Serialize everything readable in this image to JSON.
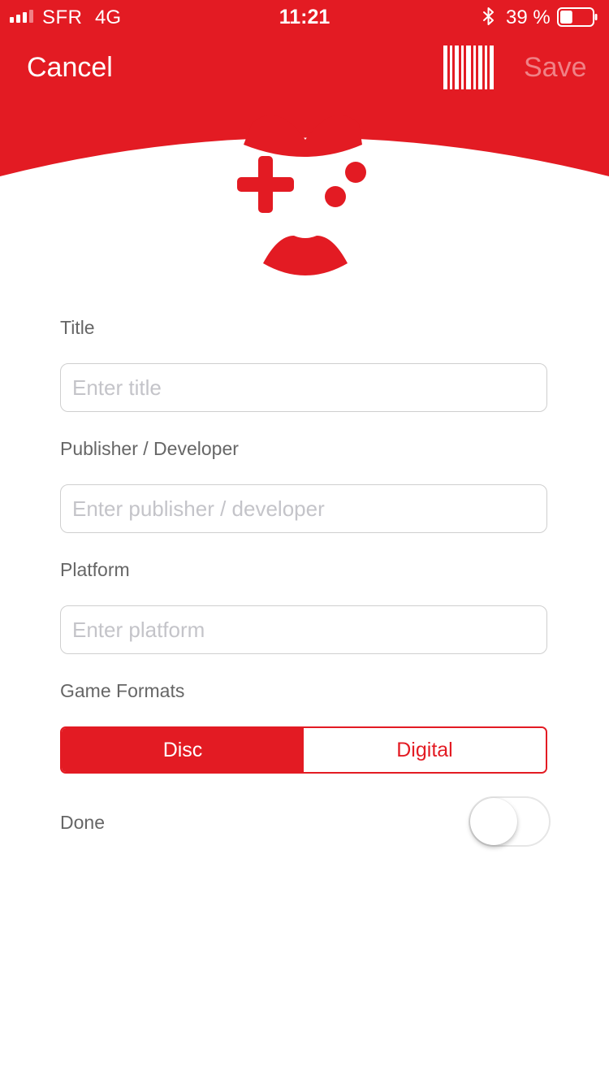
{
  "status_bar": {
    "carrier": "SFR",
    "network": "4G",
    "time": "11:21",
    "battery_percent": "39 %",
    "signal_bars_on": 3,
    "signal_bars_total": 4,
    "battery_level": 0.39
  },
  "nav": {
    "cancel_label": "Cancel",
    "save_label": "Save",
    "barcode_icon": "barcode-icon"
  },
  "form": {
    "title_label": "Title",
    "title_placeholder": "Enter title",
    "title_value": "",
    "publisher_label": "Publisher / Developer",
    "publisher_placeholder": "Enter publisher / developer",
    "publisher_value": "",
    "platform_label": "Platform",
    "platform_placeholder": "Enter platform",
    "platform_value": "",
    "formats_label": "Game Formats",
    "formats": [
      "Disc",
      "Digital"
    ],
    "selected_format": "Disc",
    "done_label": "Done",
    "done_on": false
  },
  "colors": {
    "accent": "#e31b23",
    "label_text": "#666666",
    "placeholder_text": "#c4c4c9",
    "field_border": "#cfcfcf"
  }
}
